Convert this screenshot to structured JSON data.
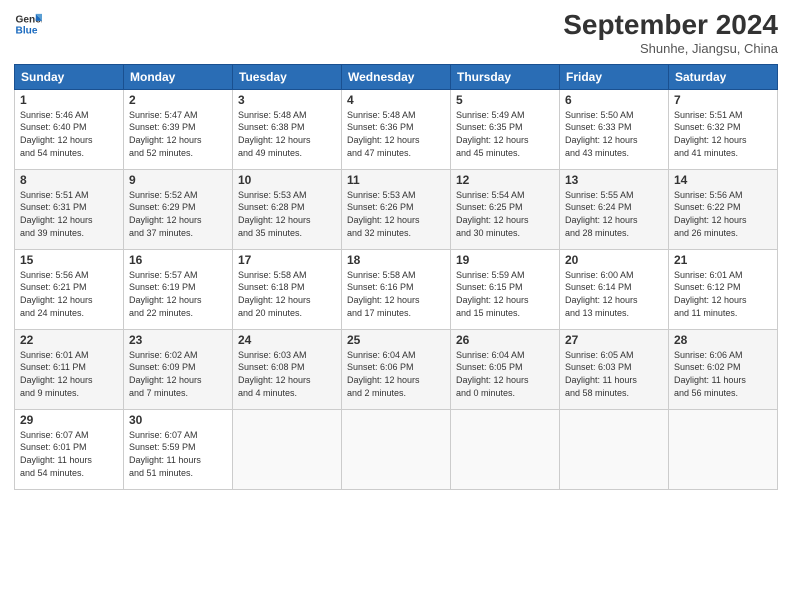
{
  "logo": {
    "line1": "General",
    "line2": "Blue"
  },
  "header": {
    "title": "September 2024",
    "subtitle": "Shunhe, Jiangsu, China"
  },
  "weekdays": [
    "Sunday",
    "Monday",
    "Tuesday",
    "Wednesday",
    "Thursday",
    "Friday",
    "Saturday"
  ],
  "weeks": [
    [
      {
        "day": "1",
        "info": "Sunrise: 5:46 AM\nSunset: 6:40 PM\nDaylight: 12 hours\nand 54 minutes."
      },
      {
        "day": "2",
        "info": "Sunrise: 5:47 AM\nSunset: 6:39 PM\nDaylight: 12 hours\nand 52 minutes."
      },
      {
        "day": "3",
        "info": "Sunrise: 5:48 AM\nSunset: 6:38 PM\nDaylight: 12 hours\nand 49 minutes."
      },
      {
        "day": "4",
        "info": "Sunrise: 5:48 AM\nSunset: 6:36 PM\nDaylight: 12 hours\nand 47 minutes."
      },
      {
        "day": "5",
        "info": "Sunrise: 5:49 AM\nSunset: 6:35 PM\nDaylight: 12 hours\nand 45 minutes."
      },
      {
        "day": "6",
        "info": "Sunrise: 5:50 AM\nSunset: 6:33 PM\nDaylight: 12 hours\nand 43 minutes."
      },
      {
        "day": "7",
        "info": "Sunrise: 5:51 AM\nSunset: 6:32 PM\nDaylight: 12 hours\nand 41 minutes."
      }
    ],
    [
      {
        "day": "8",
        "info": "Sunrise: 5:51 AM\nSunset: 6:31 PM\nDaylight: 12 hours\nand 39 minutes."
      },
      {
        "day": "9",
        "info": "Sunrise: 5:52 AM\nSunset: 6:29 PM\nDaylight: 12 hours\nand 37 minutes."
      },
      {
        "day": "10",
        "info": "Sunrise: 5:53 AM\nSunset: 6:28 PM\nDaylight: 12 hours\nand 35 minutes."
      },
      {
        "day": "11",
        "info": "Sunrise: 5:53 AM\nSunset: 6:26 PM\nDaylight: 12 hours\nand 32 minutes."
      },
      {
        "day": "12",
        "info": "Sunrise: 5:54 AM\nSunset: 6:25 PM\nDaylight: 12 hours\nand 30 minutes."
      },
      {
        "day": "13",
        "info": "Sunrise: 5:55 AM\nSunset: 6:24 PM\nDaylight: 12 hours\nand 28 minutes."
      },
      {
        "day": "14",
        "info": "Sunrise: 5:56 AM\nSunset: 6:22 PM\nDaylight: 12 hours\nand 26 minutes."
      }
    ],
    [
      {
        "day": "15",
        "info": "Sunrise: 5:56 AM\nSunset: 6:21 PM\nDaylight: 12 hours\nand 24 minutes."
      },
      {
        "day": "16",
        "info": "Sunrise: 5:57 AM\nSunset: 6:19 PM\nDaylight: 12 hours\nand 22 minutes."
      },
      {
        "day": "17",
        "info": "Sunrise: 5:58 AM\nSunset: 6:18 PM\nDaylight: 12 hours\nand 20 minutes."
      },
      {
        "day": "18",
        "info": "Sunrise: 5:58 AM\nSunset: 6:16 PM\nDaylight: 12 hours\nand 17 minutes."
      },
      {
        "day": "19",
        "info": "Sunrise: 5:59 AM\nSunset: 6:15 PM\nDaylight: 12 hours\nand 15 minutes."
      },
      {
        "day": "20",
        "info": "Sunrise: 6:00 AM\nSunset: 6:14 PM\nDaylight: 12 hours\nand 13 minutes."
      },
      {
        "day": "21",
        "info": "Sunrise: 6:01 AM\nSunset: 6:12 PM\nDaylight: 12 hours\nand 11 minutes."
      }
    ],
    [
      {
        "day": "22",
        "info": "Sunrise: 6:01 AM\nSunset: 6:11 PM\nDaylight: 12 hours\nand 9 minutes."
      },
      {
        "day": "23",
        "info": "Sunrise: 6:02 AM\nSunset: 6:09 PM\nDaylight: 12 hours\nand 7 minutes."
      },
      {
        "day": "24",
        "info": "Sunrise: 6:03 AM\nSunset: 6:08 PM\nDaylight: 12 hours\nand 4 minutes."
      },
      {
        "day": "25",
        "info": "Sunrise: 6:04 AM\nSunset: 6:06 PM\nDaylight: 12 hours\nand 2 minutes."
      },
      {
        "day": "26",
        "info": "Sunrise: 6:04 AM\nSunset: 6:05 PM\nDaylight: 12 hours\nand 0 minutes."
      },
      {
        "day": "27",
        "info": "Sunrise: 6:05 AM\nSunset: 6:03 PM\nDaylight: 11 hours\nand 58 minutes."
      },
      {
        "day": "28",
        "info": "Sunrise: 6:06 AM\nSunset: 6:02 PM\nDaylight: 11 hours\nand 56 minutes."
      }
    ],
    [
      {
        "day": "29",
        "info": "Sunrise: 6:07 AM\nSunset: 6:01 PM\nDaylight: 11 hours\nand 54 minutes."
      },
      {
        "day": "30",
        "info": "Sunrise: 6:07 AM\nSunset: 5:59 PM\nDaylight: 11 hours\nand 51 minutes."
      },
      {
        "day": "",
        "info": ""
      },
      {
        "day": "",
        "info": ""
      },
      {
        "day": "",
        "info": ""
      },
      {
        "day": "",
        "info": ""
      },
      {
        "day": "",
        "info": ""
      }
    ]
  ]
}
